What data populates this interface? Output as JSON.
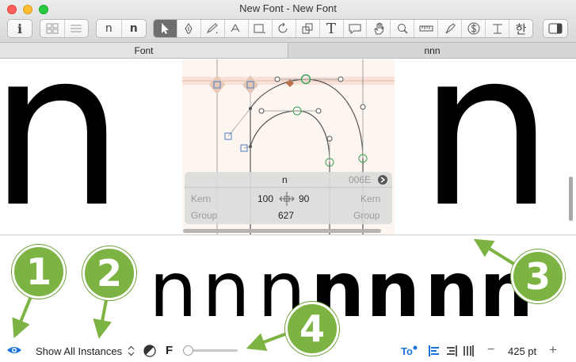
{
  "window": {
    "title": "New Font - New Font"
  },
  "toolbar": {
    "info_label": "i",
    "glyph_n_light": "n",
    "glyph_n_bold": "n",
    "text_tool": "T",
    "hangul_tool": "한"
  },
  "tabs": [
    {
      "label": "Font",
      "active": true
    },
    {
      "label": "nnn",
      "active": false
    }
  ],
  "editor": {
    "left_glyph": "n",
    "right_glyph": "n",
    "info": {
      "glyph_name": "n",
      "unicode": "006E",
      "kern_left_label": "Kern",
      "kern_right_label": "Kern",
      "lsb": "100",
      "rsb": "90",
      "group_left_label": "Group",
      "group_right_label": "Group",
      "width": "627"
    }
  },
  "preview": {
    "glyphs": [
      "n",
      "n",
      "n",
      "n",
      "n",
      "n",
      "n"
    ]
  },
  "bottom_bar": {
    "instances_label": "Show All Instances",
    "f_label": "F",
    "slider_level": 0,
    "zoom_value": "425 pt",
    "minus_label": "−",
    "plus_label": "+"
  },
  "callouts": [
    "1",
    "2",
    "3",
    "4"
  ],
  "colors": {
    "callout": "#7cb342",
    "accent": "#1a73d9"
  }
}
